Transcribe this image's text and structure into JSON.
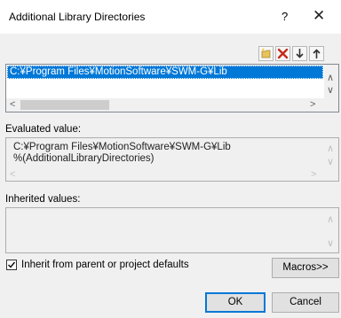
{
  "window": {
    "title": "Additional Library Directories",
    "help_glyph": "?",
    "close_glyph": "✕"
  },
  "toolbar": {
    "buttons": [
      {
        "icon": "new-line-icon"
      },
      {
        "icon": "delete-icon"
      },
      {
        "icon": "move-down-icon"
      },
      {
        "icon": "move-up-icon"
      }
    ]
  },
  "directories": {
    "items": [
      "C:¥Program Files¥MotionSoftware¥SWM-G¥Lib"
    ]
  },
  "evaluated": {
    "label": "Evaluated value:",
    "lines": [
      "C:¥Program Files¥MotionSoftware¥SWM-G¥Lib",
      "%(AdditionalLibraryDirectories)"
    ]
  },
  "inherited": {
    "label": "Inherited values:"
  },
  "inherit_checkbox": {
    "label": "Inherit from parent or project defaults",
    "checked": true
  },
  "buttons": {
    "macros": "Macros>>",
    "ok": "OK",
    "cancel": "Cancel"
  },
  "colors": {
    "selection": "#0078d7",
    "delete_red": "#c42b1c",
    "dialog_bg": "#f0f0f0"
  }
}
